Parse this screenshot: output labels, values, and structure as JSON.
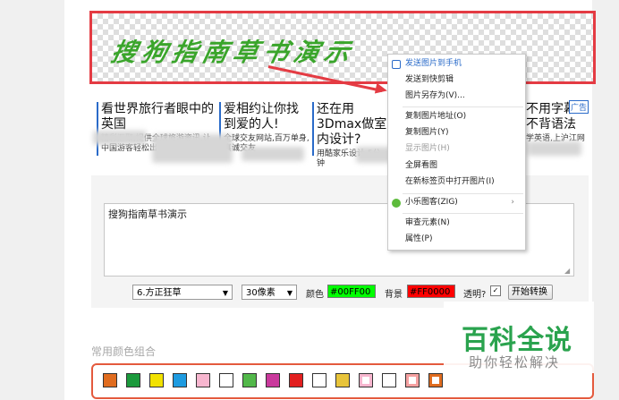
{
  "preview": {
    "text": "搜狗指南草书演示",
    "text_color": "#3aa52b",
    "border_color": "#e43b43"
  },
  "ads": [
    {
      "title": "看世界旅行者眼中的英国",
      "snippet": "精彩汇聚,提供全球旅游资讯,让中国游客轻松出游,吃喝玩乐更"
    },
    {
      "title": "爱相约让你找到爱的人!",
      "snippet": "全球交友网站,百万单身,真诚交友"
    },
    {
      "title": "还在用3Dmax做室内设计?",
      "snippet": "用酷家乐设计,5分钟"
    },
    {
      "title": "不用字幕·不背语法",
      "snippet": "学英语,上沪江网"
    }
  ],
  "ad_badge": "广告",
  "context_menu": [
    {
      "label": "发送图片到手机",
      "state": "highlight",
      "icon": "phone-icon"
    },
    {
      "label": "发送到快剪辑",
      "state": "normal"
    },
    {
      "label": "图片另存为(V)...",
      "state": "normal"
    },
    {
      "label": "复制图片地址(O)",
      "state": "normal"
    },
    {
      "label": "复制图片(Y)",
      "state": "normal"
    },
    {
      "label": "显示图片(H)",
      "state": "disabled"
    },
    {
      "label": "全屏看图",
      "state": "normal"
    },
    {
      "label": "在新标签页中打开图片(I)",
      "state": "normal"
    },
    {
      "label": "小乐图客(ZIG)",
      "state": "normal",
      "icon": "zig-icon",
      "submenu": true
    },
    {
      "label": "审查元素(N)",
      "state": "normal"
    },
    {
      "label": "属性(P)",
      "state": "normal"
    }
  ],
  "form": {
    "text_value": "搜狗指南草书演示",
    "font_select": "6.方正狂草",
    "size_select": "30像素",
    "color_label": "颜色",
    "color_value": "#00FF00",
    "bg_label": "背景",
    "bg_value": "#FF0000",
    "transparent_label": "透明?",
    "transparent_checked": true,
    "checkbox_glyph": "✓",
    "caret": "▼",
    "submenu_arrow": "›",
    "convert_button": "开始转换"
  },
  "combos": {
    "title": "常用颜色组合",
    "swatches": [
      [
        "#e06c1f",
        "#e06c1f"
      ],
      [
        "#1b9a3c",
        "#1b9a3c"
      ],
      [
        "#f2e200",
        "#f2e200"
      ],
      [
        "#1e9be0",
        "#1e9be0"
      ],
      [
        "#f7b6cf",
        "#f7b6cf"
      ],
      [
        "#ffffff",
        "#ffffff"
      ],
      [
        "#52b84a",
        "#52b84a"
      ],
      [
        "#c9399c",
        "#c9399c"
      ],
      [
        "#e21f1f",
        "#e21f1f"
      ],
      [
        "#ffffff",
        "#ffffff"
      ],
      [
        "#e8c43a",
        "#e8c43a"
      ],
      [
        "#f7b6cf",
        "#ffffff"
      ],
      [
        "#ffffff",
        "#ffffff"
      ],
      [
        "#f5a0a0",
        "#ffffff"
      ],
      [
        "#e06c1f",
        "#ffffff"
      ]
    ]
  },
  "watermark": {
    "title": "百科全说",
    "subtitle": "助你轻松解决"
  }
}
